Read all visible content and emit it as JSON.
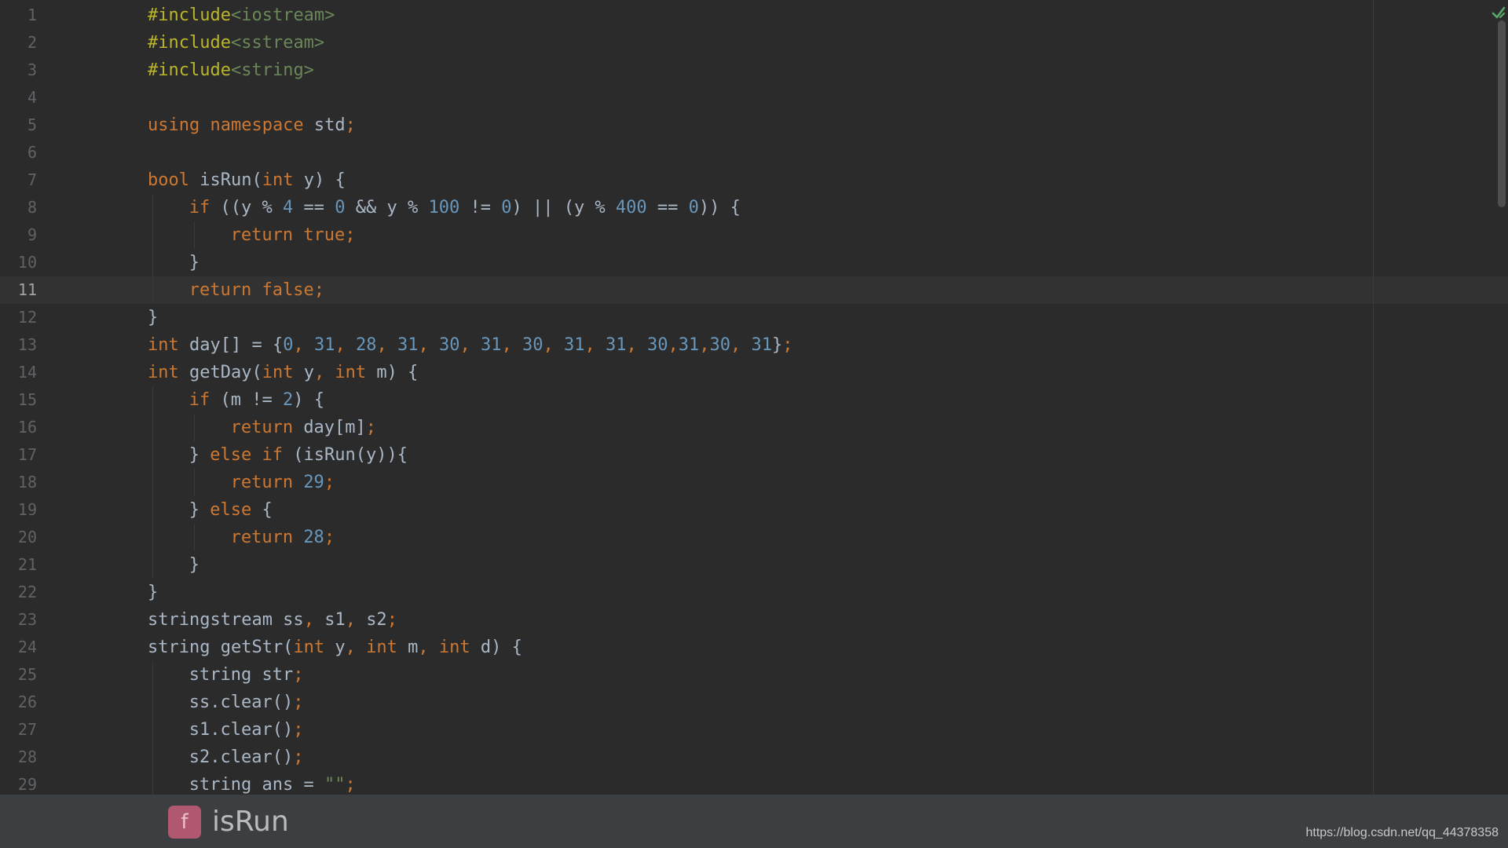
{
  "editor": {
    "current_line": 11,
    "lines": [
      {
        "n": "1",
        "indent": 0,
        "tokens": [
          [
            "pp",
            "#include"
          ],
          [
            "inc",
            "<iostream>"
          ]
        ]
      },
      {
        "n": "2",
        "indent": 0,
        "tokens": [
          [
            "pp",
            "#include"
          ],
          [
            "inc",
            "<sstream>"
          ]
        ]
      },
      {
        "n": "3",
        "indent": 0,
        "tokens": [
          [
            "pp",
            "#include"
          ],
          [
            "inc",
            "<string>"
          ]
        ]
      },
      {
        "n": "4",
        "indent": 0,
        "tokens": []
      },
      {
        "n": "5",
        "indent": 0,
        "tokens": [
          [
            "kw",
            "using namespace "
          ],
          [
            "plain",
            "std"
          ],
          [
            "kw",
            ";"
          ]
        ]
      },
      {
        "n": "6",
        "indent": 0,
        "tokens": []
      },
      {
        "n": "7",
        "indent": 0,
        "tokens": [
          [
            "kw",
            "bool "
          ],
          [
            "plain",
            "isRun("
          ],
          [
            "kw",
            "int "
          ],
          [
            "plain",
            "y) {"
          ]
        ]
      },
      {
        "n": "8",
        "indent": 1,
        "tokens": [
          [
            "kw",
            "if "
          ],
          [
            "plain",
            "((y % "
          ],
          [
            "num",
            "4"
          ],
          [
            "plain",
            " == "
          ],
          [
            "num",
            "0"
          ],
          [
            "plain",
            " && y % "
          ],
          [
            "num",
            "100"
          ],
          [
            "plain",
            " != "
          ],
          [
            "num",
            "0"
          ],
          [
            "plain",
            ") || (y % "
          ],
          [
            "num",
            "400"
          ],
          [
            "plain",
            " == "
          ],
          [
            "num",
            "0"
          ],
          [
            "plain",
            ")) {"
          ]
        ]
      },
      {
        "n": "9",
        "indent": 2,
        "tokens": [
          [
            "kw",
            "return true;"
          ]
        ]
      },
      {
        "n": "10",
        "indent": 1,
        "tokens": [
          [
            "plain",
            "}"
          ]
        ]
      },
      {
        "n": "11",
        "indent": 1,
        "tokens": [
          [
            "kw",
            "return false;"
          ]
        ]
      },
      {
        "n": "12",
        "indent": 0,
        "tokens": [
          [
            "plain",
            "}"
          ]
        ]
      },
      {
        "n": "13",
        "indent": 0,
        "tokens": [
          [
            "kw",
            "int "
          ],
          [
            "plain",
            "day[] = {"
          ],
          [
            "num",
            "0"
          ],
          [
            "kw",
            ", "
          ],
          [
            "num",
            "31"
          ],
          [
            "kw",
            ", "
          ],
          [
            "num",
            "28"
          ],
          [
            "kw",
            ", "
          ],
          [
            "num",
            "31"
          ],
          [
            "kw",
            ", "
          ],
          [
            "num",
            "30"
          ],
          [
            "kw",
            ", "
          ],
          [
            "num",
            "31"
          ],
          [
            "kw",
            ", "
          ],
          [
            "num",
            "30"
          ],
          [
            "kw",
            ", "
          ],
          [
            "num",
            "31"
          ],
          [
            "kw",
            ", "
          ],
          [
            "num",
            "31"
          ],
          [
            "kw",
            ", "
          ],
          [
            "num",
            "30"
          ],
          [
            "kw",
            ","
          ],
          [
            "num",
            "31"
          ],
          [
            "kw",
            ","
          ],
          [
            "num",
            "30"
          ],
          [
            "kw",
            ", "
          ],
          [
            "num",
            "31"
          ],
          [
            "plain",
            "}"
          ],
          [
            "kw",
            ";"
          ]
        ]
      },
      {
        "n": "14",
        "indent": 0,
        "tokens": [
          [
            "kw",
            "int "
          ],
          [
            "plain",
            "getDay("
          ],
          [
            "kw",
            "int "
          ],
          [
            "plain",
            "y"
          ],
          [
            "kw",
            ", int "
          ],
          [
            "plain",
            "m) {"
          ]
        ]
      },
      {
        "n": "15",
        "indent": 1,
        "tokens": [
          [
            "kw",
            "if "
          ],
          [
            "plain",
            "(m != "
          ],
          [
            "num",
            "2"
          ],
          [
            "plain",
            ") {"
          ]
        ]
      },
      {
        "n": "16",
        "indent": 2,
        "tokens": [
          [
            "kw",
            "return "
          ],
          [
            "plain",
            "day[m]"
          ],
          [
            "kw",
            ";"
          ]
        ]
      },
      {
        "n": "17",
        "indent": 1,
        "tokens": [
          [
            "plain",
            "} "
          ],
          [
            "kw",
            "else if "
          ],
          [
            "plain",
            "(isRun(y)){"
          ]
        ]
      },
      {
        "n": "18",
        "indent": 2,
        "tokens": [
          [
            "kw",
            "return "
          ],
          [
            "num",
            "29"
          ],
          [
            "kw",
            ";"
          ]
        ]
      },
      {
        "n": "19",
        "indent": 1,
        "tokens": [
          [
            "plain",
            "} "
          ],
          [
            "kw",
            "else "
          ],
          [
            "plain",
            "{"
          ]
        ]
      },
      {
        "n": "20",
        "indent": 2,
        "tokens": [
          [
            "kw",
            "return "
          ],
          [
            "num",
            "28"
          ],
          [
            "kw",
            ";"
          ]
        ]
      },
      {
        "n": "21",
        "indent": 1,
        "tokens": [
          [
            "plain",
            "}"
          ]
        ]
      },
      {
        "n": "22",
        "indent": 0,
        "tokens": [
          [
            "plain",
            "}"
          ]
        ]
      },
      {
        "n": "23",
        "indent": 0,
        "tokens": [
          [
            "plain",
            "stringstream ss"
          ],
          [
            "kw",
            ", "
          ],
          [
            "plain",
            "s1"
          ],
          [
            "kw",
            ", "
          ],
          [
            "plain",
            "s2"
          ],
          [
            "kw",
            ";"
          ]
        ]
      },
      {
        "n": "24",
        "indent": 0,
        "tokens": [
          [
            "plain",
            "string getStr("
          ],
          [
            "kw",
            "int "
          ],
          [
            "plain",
            "y"
          ],
          [
            "kw",
            ", int "
          ],
          [
            "plain",
            "m"
          ],
          [
            "kw",
            ", int "
          ],
          [
            "plain",
            "d) {"
          ]
        ]
      },
      {
        "n": "25",
        "indent": 1,
        "tokens": [
          [
            "plain",
            "string str"
          ],
          [
            "kw",
            ";"
          ]
        ]
      },
      {
        "n": "26",
        "indent": 1,
        "tokens": [
          [
            "plain",
            "ss.clear()"
          ],
          [
            "kw",
            ";"
          ]
        ]
      },
      {
        "n": "27",
        "indent": 1,
        "tokens": [
          [
            "plain",
            "s1.clear()"
          ],
          [
            "kw",
            ";"
          ]
        ]
      },
      {
        "n": "28",
        "indent": 1,
        "tokens": [
          [
            "plain",
            "s2.clear()"
          ],
          [
            "kw",
            ";"
          ]
        ]
      },
      {
        "n": "29",
        "indent": 1,
        "tokens": [
          [
            "plain",
            "string ans = "
          ],
          [
            "str",
            "\"\""
          ],
          [
            "kw",
            ";"
          ]
        ]
      }
    ]
  },
  "breadcrumb": {
    "badge_letter": "f",
    "function_name": "isRun"
  },
  "watermark": "https://blog.csdn.net/qq_44378358",
  "icons": {
    "inspection": "checkmark-icon",
    "function_badge": "function-icon"
  },
  "colors": {
    "background": "#2b2b2b",
    "keyword": "#cc7832",
    "number": "#6897bb",
    "string": "#6a8759",
    "preprocessor": "#bbb529",
    "identifier": "#a9b7c6",
    "current_line": "#323232",
    "function_badge": "#b0586f"
  }
}
